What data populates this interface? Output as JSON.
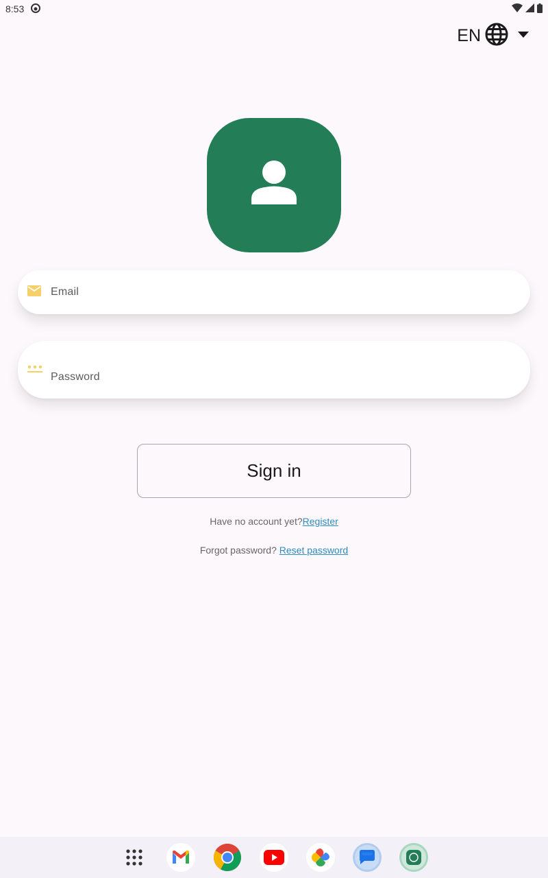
{
  "status_bar": {
    "time": "8:53"
  },
  "language": {
    "code": "EN"
  },
  "form": {
    "email_label": "Email",
    "password_label": "Password",
    "signin_label": "Sign in"
  },
  "links": {
    "no_account_text": "Have no account yet?",
    "register_label": "Register",
    "forgot_text": "Forgot password? ",
    "reset_label": "Reset password"
  },
  "colors": {
    "brand_green": "#237e58",
    "icon_yellow": "#f7cf6a",
    "link_blue": "#2e8bc0"
  },
  "dock": {
    "items": [
      "app-drawer-icon",
      "gmail-icon",
      "chrome-icon",
      "youtube-icon",
      "photos-icon",
      "messages-icon",
      "app-icon"
    ]
  }
}
